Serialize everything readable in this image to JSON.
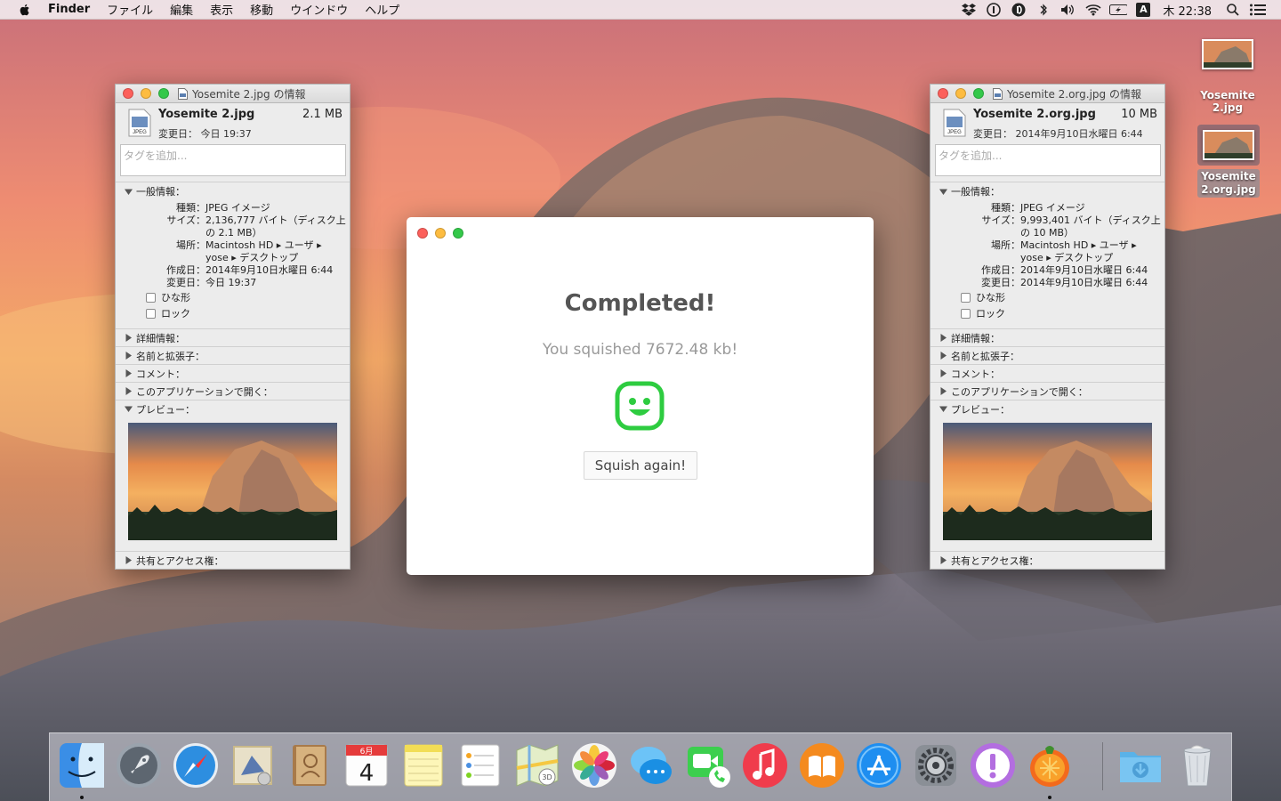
{
  "menubar": {
    "app_name": "Finder",
    "items": [
      "ファイル",
      "編集",
      "表示",
      "移動",
      "ウインドウ",
      "ヘルプ"
    ],
    "input_source": "A",
    "clock": "木 22:38"
  },
  "info_left": {
    "title": "Yosemite 2.jpg の情報",
    "file_name": "Yosemite 2.jpg",
    "file_size": "2.1 MB",
    "modified_line": "変更日： 今日 19:37",
    "tag_placeholder": "タグを追加...",
    "general_label": "一般情報：",
    "rows": [
      {
        "k": "種類：",
        "v": "JPEG イメージ"
      },
      {
        "k": "サイズ：",
        "v": "2,136,777 バイト（ディスク上の 2.1 MB）"
      },
      {
        "k": "場所：",
        "v": "Macintosh HD ▸ ユーザ ▸ yose ▸ デスクトップ"
      },
      {
        "k": "作成日：",
        "v": "2014年9月10日水曜日 6:44"
      },
      {
        "k": "変更日：",
        "v": "今日 19:37"
      }
    ],
    "stationery": "ひな形",
    "locked": "ロック",
    "sections": [
      "詳細情報：",
      "名前と拡張子：",
      "コメント：",
      "このアプリケーションで開く："
    ],
    "preview_label": "プレビュー：",
    "sharing_label": "共有とアクセス権："
  },
  "info_right": {
    "title": "Yosemite 2.org.jpg の情報",
    "file_name": "Yosemite 2.org.jpg",
    "file_size": "10 MB",
    "modified_line": "変更日： 2014年9月10日水曜日 6:44",
    "tag_placeholder": "タグを追加...",
    "general_label": "一般情報：",
    "rows": [
      {
        "k": "種類：",
        "v": "JPEG イメージ"
      },
      {
        "k": "サイズ：",
        "v": "9,993,401 バイト（ディスク上の 10 MB）"
      },
      {
        "k": "場所：",
        "v": "Macintosh HD ▸ ユーザ ▸ yose ▸ デスクトップ"
      },
      {
        "k": "作成日：",
        "v": "2014年9月10日水曜日 6:44"
      },
      {
        "k": "変更日：",
        "v": "2014年9月10日水曜日 6:44"
      }
    ],
    "stationery": "ひな形",
    "locked": "ロック",
    "sections": [
      "詳細情報：",
      "名前と拡張子：",
      "コメント：",
      "このアプリケーションで開く："
    ],
    "preview_label": "プレビュー：",
    "sharing_label": "共有とアクセス権："
  },
  "dialog": {
    "heading": "Completed!",
    "message": "You squished 7672.48 kb!",
    "button_label": "Squish again!",
    "accent_color": "#2ecc40"
  },
  "desktop_icons": [
    {
      "label": "Yosemite 2.jpg"
    },
    {
      "label": "Yosemite 2.org.jpg"
    }
  ],
  "calendar_icon": {
    "month": "6月",
    "day": "4"
  },
  "dock_apps": [
    "Finder",
    "Launchpad",
    "Safari",
    "Mail",
    "Contacts",
    "Calendar",
    "Notes",
    "Reminders",
    "Maps",
    "Photos",
    "Messages",
    "FaceTime",
    "iTunes",
    "iBooks",
    "App Store",
    "System Preferences",
    "Feedback",
    "ImageOptim",
    "Downloads",
    "Trash"
  ]
}
